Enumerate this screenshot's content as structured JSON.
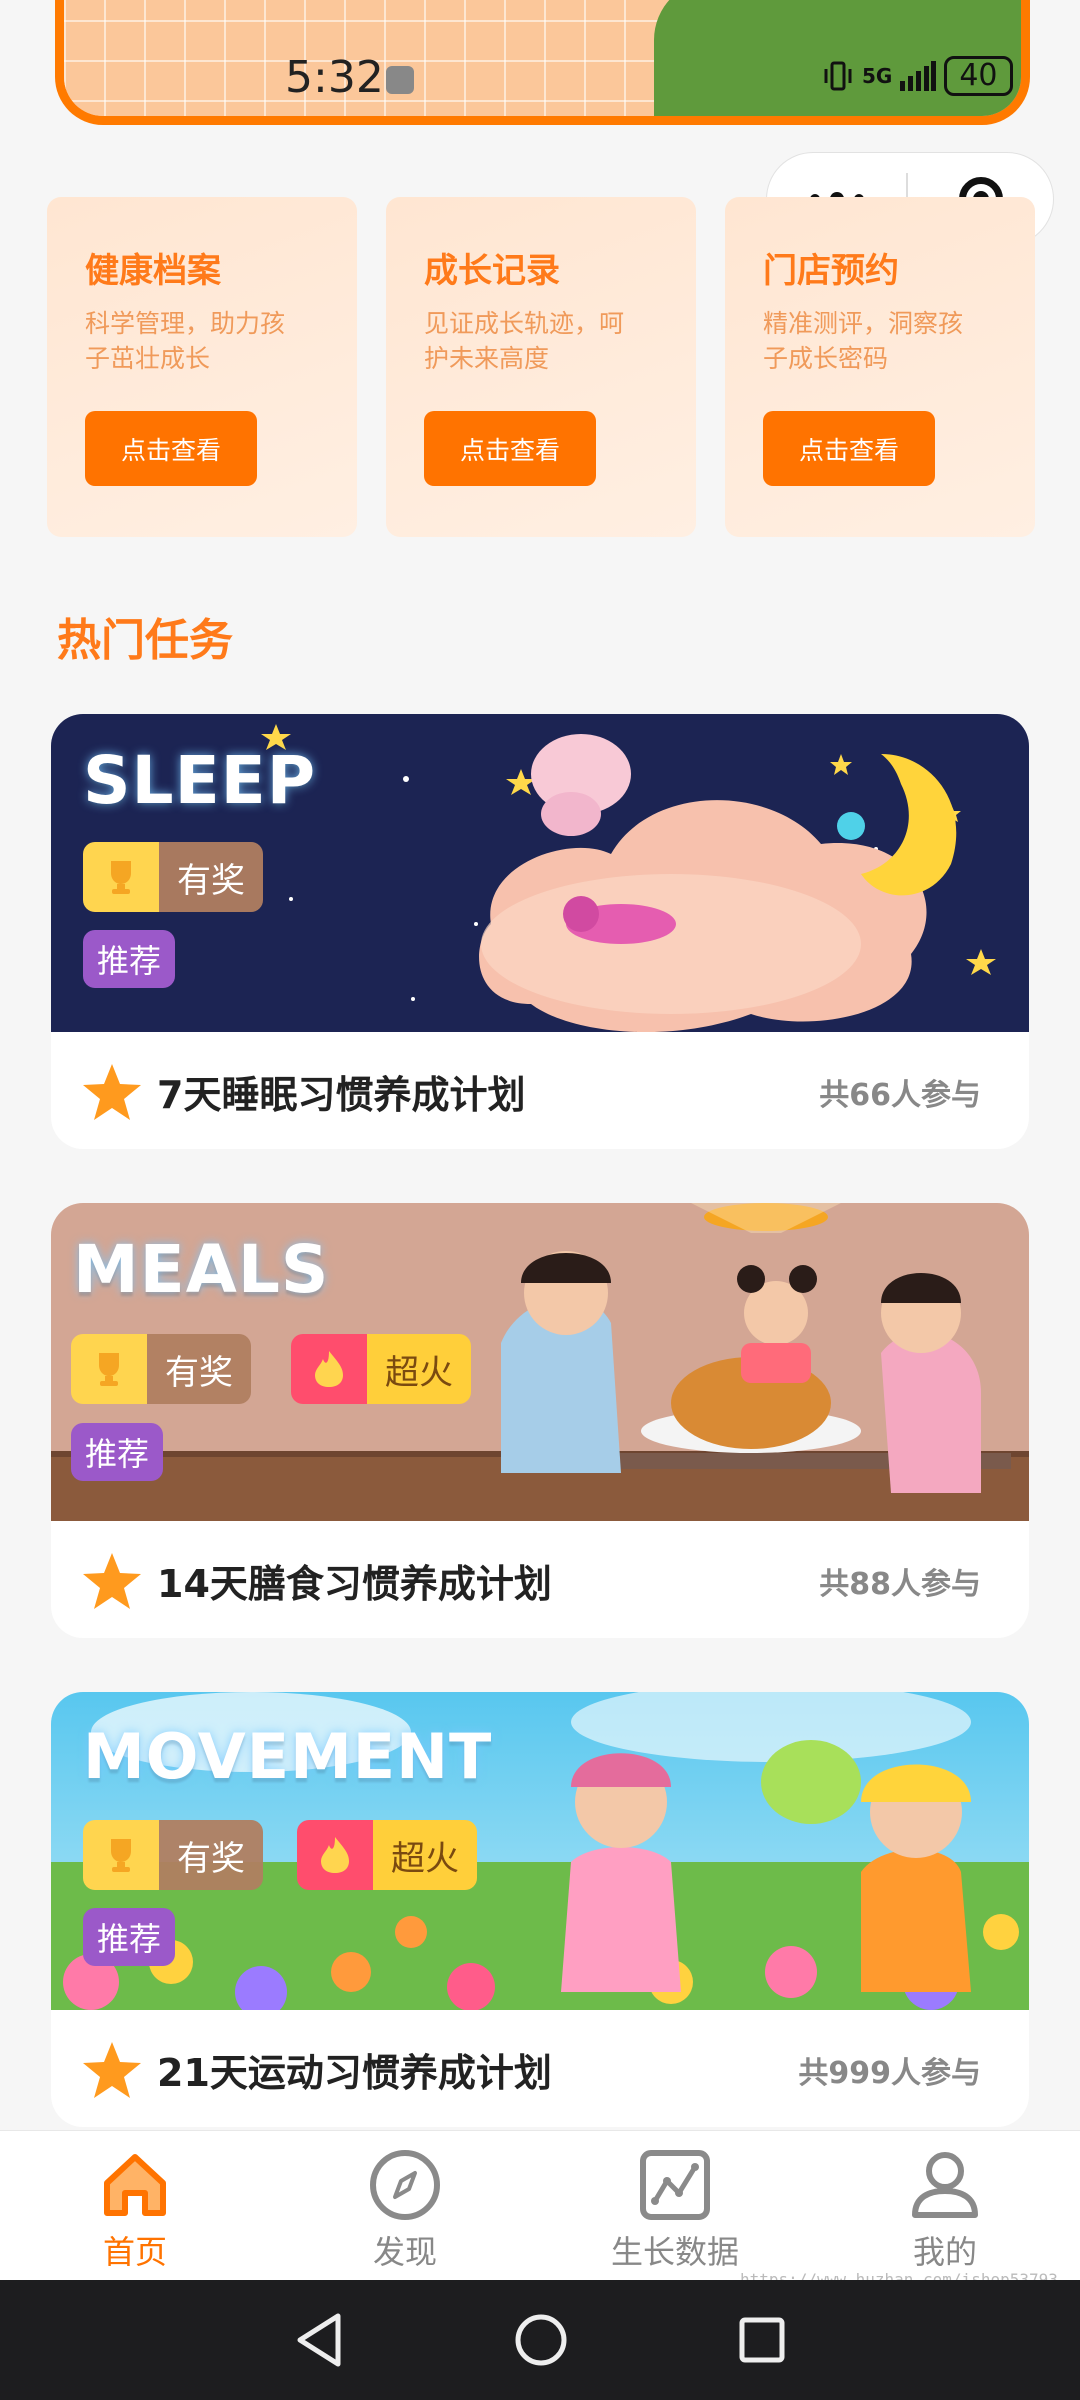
{
  "status_bar": {
    "time": "5:32",
    "network": "5G",
    "battery": "40"
  },
  "features": [
    {
      "title": "健康档案",
      "desc": "科学管理，助力孩子茁壮成长",
      "button": "点击查看"
    },
    {
      "title": "成长记录",
      "desc": "见证成长轨迹，呵护未来高度",
      "button": "点击查看"
    },
    {
      "title": "门店预约",
      "desc": "精准测评，洞察孩子成长密码",
      "button": "点击查看"
    }
  ],
  "section_title": "热门任务",
  "tasks": [
    {
      "banner_word": "SLEEP",
      "badges": [
        "有奖"
      ],
      "recommend": "推荐",
      "name": "7天睡眠习惯养成计划",
      "count": "共66人参与"
    },
    {
      "banner_word": "MEALS",
      "badges": [
        "有奖",
        "超火"
      ],
      "recommend": "推荐",
      "name": "14天膳食习惯养成计划",
      "count": "共88人参与"
    },
    {
      "banner_word": "MOVEMENT",
      "badges": [
        "有奖",
        "超火"
      ],
      "recommend": "推荐",
      "name": "21天运动习惯养成计划",
      "count": "共999人参与"
    }
  ],
  "tabs": [
    {
      "label": "首页",
      "icon": "home-icon",
      "active": true
    },
    {
      "label": "发现",
      "icon": "compass-icon",
      "active": false
    },
    {
      "label": "生长数据",
      "icon": "chart-icon",
      "active": false
    },
    {
      "label": "我的",
      "icon": "user-icon",
      "active": false
    }
  ],
  "watermark": "https://www.huzhan.com/ishop53793",
  "colors": {
    "accent": "#ff7300",
    "title_orange": "#ff7a1a",
    "recommend_purple": "#9b59c9"
  }
}
